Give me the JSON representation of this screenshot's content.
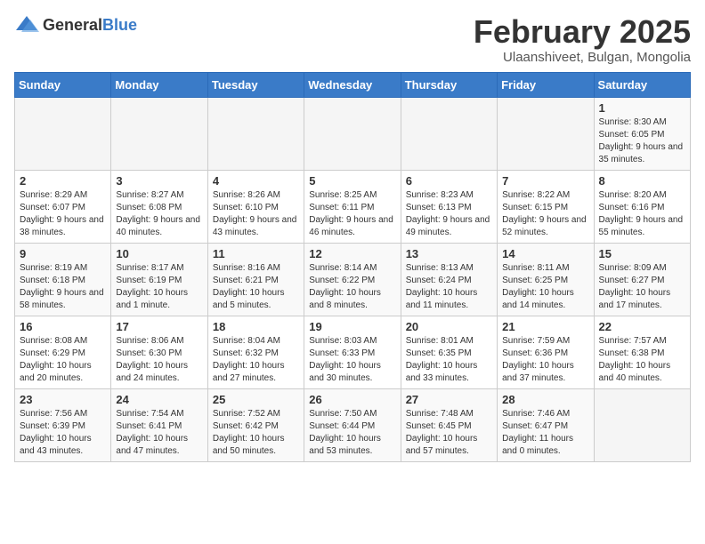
{
  "header": {
    "logo_general": "General",
    "logo_blue": "Blue",
    "title": "February 2025",
    "subtitle": "Ulaanshiveet, Bulgan, Mongolia"
  },
  "weekdays": [
    "Sunday",
    "Monday",
    "Tuesday",
    "Wednesday",
    "Thursday",
    "Friday",
    "Saturday"
  ],
  "weeks": [
    [
      {
        "day": "",
        "info": ""
      },
      {
        "day": "",
        "info": ""
      },
      {
        "day": "",
        "info": ""
      },
      {
        "day": "",
        "info": ""
      },
      {
        "day": "",
        "info": ""
      },
      {
        "day": "",
        "info": ""
      },
      {
        "day": "1",
        "info": "Sunrise: 8:30 AM\nSunset: 6:05 PM\nDaylight: 9 hours and 35 minutes."
      }
    ],
    [
      {
        "day": "2",
        "info": "Sunrise: 8:29 AM\nSunset: 6:07 PM\nDaylight: 9 hours and 38 minutes."
      },
      {
        "day": "3",
        "info": "Sunrise: 8:27 AM\nSunset: 6:08 PM\nDaylight: 9 hours and 40 minutes."
      },
      {
        "day": "4",
        "info": "Sunrise: 8:26 AM\nSunset: 6:10 PM\nDaylight: 9 hours and 43 minutes."
      },
      {
        "day": "5",
        "info": "Sunrise: 8:25 AM\nSunset: 6:11 PM\nDaylight: 9 hours and 46 minutes."
      },
      {
        "day": "6",
        "info": "Sunrise: 8:23 AM\nSunset: 6:13 PM\nDaylight: 9 hours and 49 minutes."
      },
      {
        "day": "7",
        "info": "Sunrise: 8:22 AM\nSunset: 6:15 PM\nDaylight: 9 hours and 52 minutes."
      },
      {
        "day": "8",
        "info": "Sunrise: 8:20 AM\nSunset: 6:16 PM\nDaylight: 9 hours and 55 minutes."
      }
    ],
    [
      {
        "day": "9",
        "info": "Sunrise: 8:19 AM\nSunset: 6:18 PM\nDaylight: 9 hours and 58 minutes."
      },
      {
        "day": "10",
        "info": "Sunrise: 8:17 AM\nSunset: 6:19 PM\nDaylight: 10 hours and 1 minute."
      },
      {
        "day": "11",
        "info": "Sunrise: 8:16 AM\nSunset: 6:21 PM\nDaylight: 10 hours and 5 minutes."
      },
      {
        "day": "12",
        "info": "Sunrise: 8:14 AM\nSunset: 6:22 PM\nDaylight: 10 hours and 8 minutes."
      },
      {
        "day": "13",
        "info": "Sunrise: 8:13 AM\nSunset: 6:24 PM\nDaylight: 10 hours and 11 minutes."
      },
      {
        "day": "14",
        "info": "Sunrise: 8:11 AM\nSunset: 6:25 PM\nDaylight: 10 hours and 14 minutes."
      },
      {
        "day": "15",
        "info": "Sunrise: 8:09 AM\nSunset: 6:27 PM\nDaylight: 10 hours and 17 minutes."
      }
    ],
    [
      {
        "day": "16",
        "info": "Sunrise: 8:08 AM\nSunset: 6:29 PM\nDaylight: 10 hours and 20 minutes."
      },
      {
        "day": "17",
        "info": "Sunrise: 8:06 AM\nSunset: 6:30 PM\nDaylight: 10 hours and 24 minutes."
      },
      {
        "day": "18",
        "info": "Sunrise: 8:04 AM\nSunset: 6:32 PM\nDaylight: 10 hours and 27 minutes."
      },
      {
        "day": "19",
        "info": "Sunrise: 8:03 AM\nSunset: 6:33 PM\nDaylight: 10 hours and 30 minutes."
      },
      {
        "day": "20",
        "info": "Sunrise: 8:01 AM\nSunset: 6:35 PM\nDaylight: 10 hours and 33 minutes."
      },
      {
        "day": "21",
        "info": "Sunrise: 7:59 AM\nSunset: 6:36 PM\nDaylight: 10 hours and 37 minutes."
      },
      {
        "day": "22",
        "info": "Sunrise: 7:57 AM\nSunset: 6:38 PM\nDaylight: 10 hours and 40 minutes."
      }
    ],
    [
      {
        "day": "23",
        "info": "Sunrise: 7:56 AM\nSunset: 6:39 PM\nDaylight: 10 hours and 43 minutes."
      },
      {
        "day": "24",
        "info": "Sunrise: 7:54 AM\nSunset: 6:41 PM\nDaylight: 10 hours and 47 minutes."
      },
      {
        "day": "25",
        "info": "Sunrise: 7:52 AM\nSunset: 6:42 PM\nDaylight: 10 hours and 50 minutes."
      },
      {
        "day": "26",
        "info": "Sunrise: 7:50 AM\nSunset: 6:44 PM\nDaylight: 10 hours and 53 minutes."
      },
      {
        "day": "27",
        "info": "Sunrise: 7:48 AM\nSunset: 6:45 PM\nDaylight: 10 hours and 57 minutes."
      },
      {
        "day": "28",
        "info": "Sunrise: 7:46 AM\nSunset: 6:47 PM\nDaylight: 11 hours and 0 minutes."
      },
      {
        "day": "",
        "info": ""
      }
    ]
  ]
}
